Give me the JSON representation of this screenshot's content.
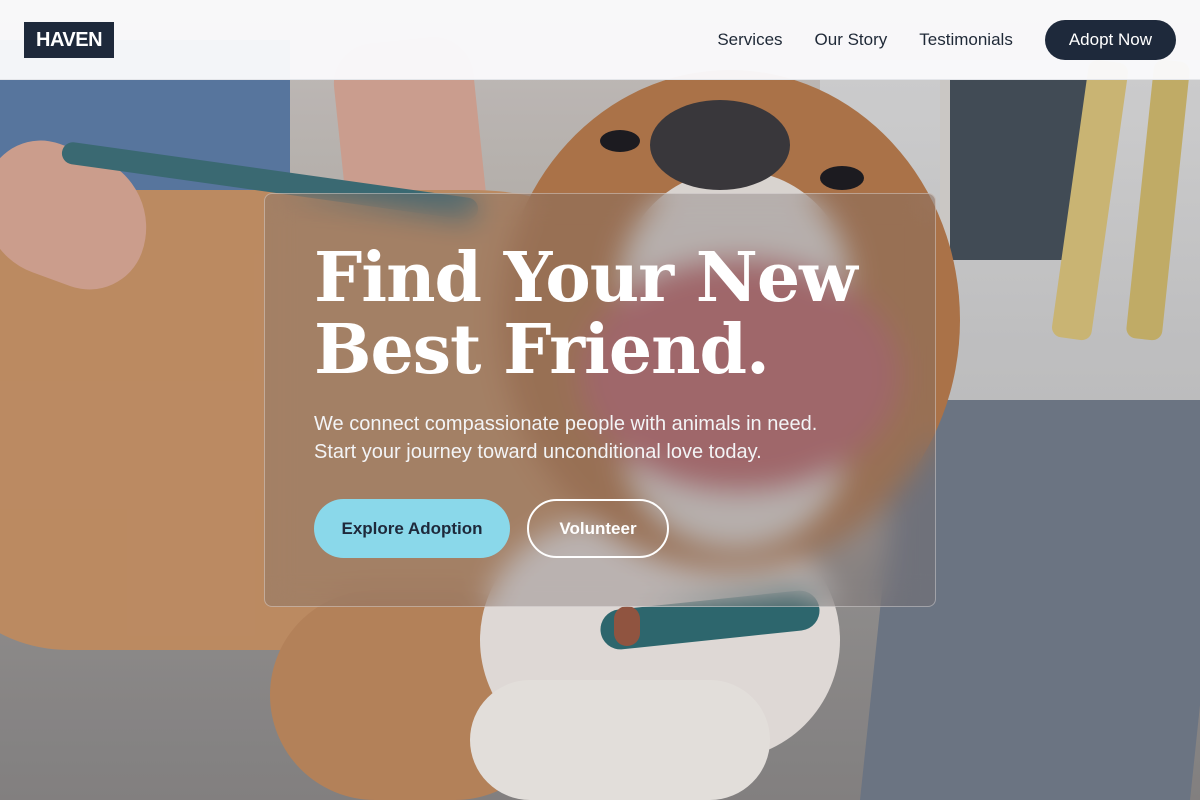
{
  "brand": {
    "logo_text": "HAVEN"
  },
  "nav": {
    "links": [
      "Services",
      "Our Story",
      "Testimonials"
    ],
    "cta_label": "Adopt Now"
  },
  "hero": {
    "title_line1": "Find Your New",
    "title_line2": "Best Friend.",
    "subtitle_line1": "We connect compassionate people with animals in need.",
    "subtitle_line2": "Start your journey toward unconditional love today.",
    "primary_button": "Explore Adoption",
    "secondary_button": "Volunteer",
    "background_image": "dog-photo"
  },
  "colors": {
    "brand_dark": "#1e293b",
    "accent_cyan": "#8ad8ea",
    "white": "#ffffff"
  }
}
